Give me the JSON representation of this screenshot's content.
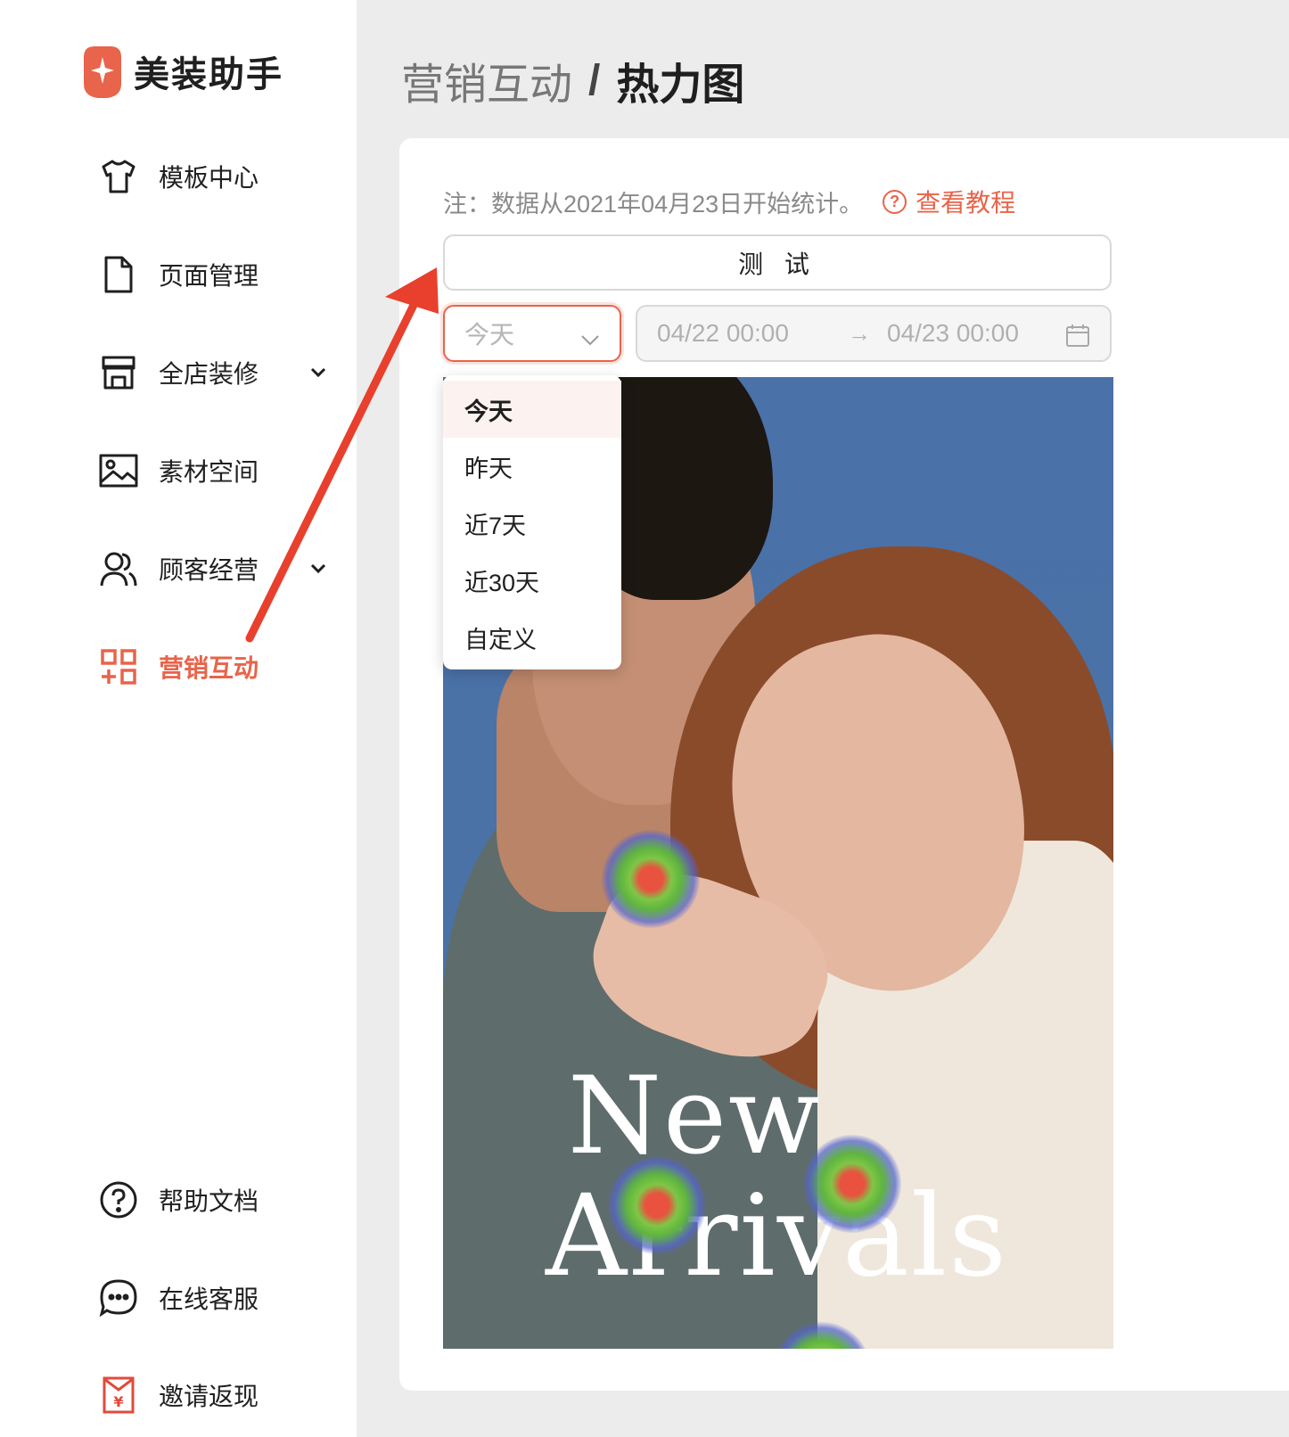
{
  "app": {
    "name": "美装助手",
    "brand_color": "#e8644a"
  },
  "sidebar": {
    "items": [
      {
        "label": "模板中心",
        "icon": "tshirt-icon"
      },
      {
        "label": "页面管理",
        "icon": "document-icon"
      },
      {
        "label": "全店装修",
        "icon": "store-icon",
        "expandable": true
      },
      {
        "label": "素材空间",
        "icon": "image-icon"
      },
      {
        "label": "顾客经营",
        "icon": "users-icon",
        "expandable": true
      },
      {
        "label": "营销互动",
        "icon": "apps-icon",
        "active": true
      }
    ],
    "bottom_items": [
      {
        "label": "帮助文档",
        "icon": "help-circle-icon"
      },
      {
        "label": "在线客服",
        "icon": "chat-bubble-icon"
      },
      {
        "label": "邀请返现",
        "icon": "red-envelope-icon"
      }
    ]
  },
  "breadcrumb": {
    "parent": "营销互动",
    "separator": "/",
    "current": "热力图"
  },
  "main": {
    "note": "注：数据从2021年04月23日开始统计。",
    "tutorial_link": "查看教程",
    "test_button": "测 试",
    "range_select": {
      "placeholder": "今天",
      "options": [
        "今天",
        "昨天",
        "近7天",
        "近30天",
        "自定义"
      ],
      "selected": "今天"
    },
    "date_range": {
      "start": "04/22 00:00",
      "arrow": "→",
      "end": "04/23 00:00"
    },
    "preview_image": {
      "title_line_1": "New",
      "title_line_2": "Arrivals"
    }
  }
}
